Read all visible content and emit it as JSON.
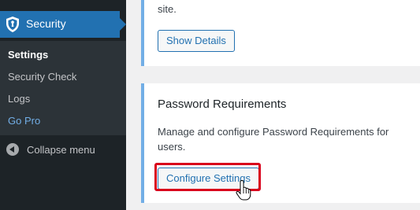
{
  "sidebar": {
    "parent": {
      "label": "Security",
      "icon": "shield-icon"
    },
    "items": [
      {
        "label": "Settings"
      },
      {
        "label": "Security Check"
      },
      {
        "label": "Logs"
      },
      {
        "label": "Go Pro"
      }
    ],
    "collapse": {
      "label": "Collapse menu",
      "icon": "collapse-arrow-icon"
    }
  },
  "card_top": {
    "text_fragment": "site.",
    "button_label": "Show Details"
  },
  "card_bottom": {
    "title": "Password Requirements",
    "description_line1": "Manage and configure Password Requirements for",
    "description_line2": "users.",
    "button_label": "Configure Settings"
  },
  "colors": {
    "sidebar_bg": "#1d2327",
    "active_menu": "#2271b1",
    "highlight_box": "#d9001b",
    "accent_border": "#72aee6"
  }
}
